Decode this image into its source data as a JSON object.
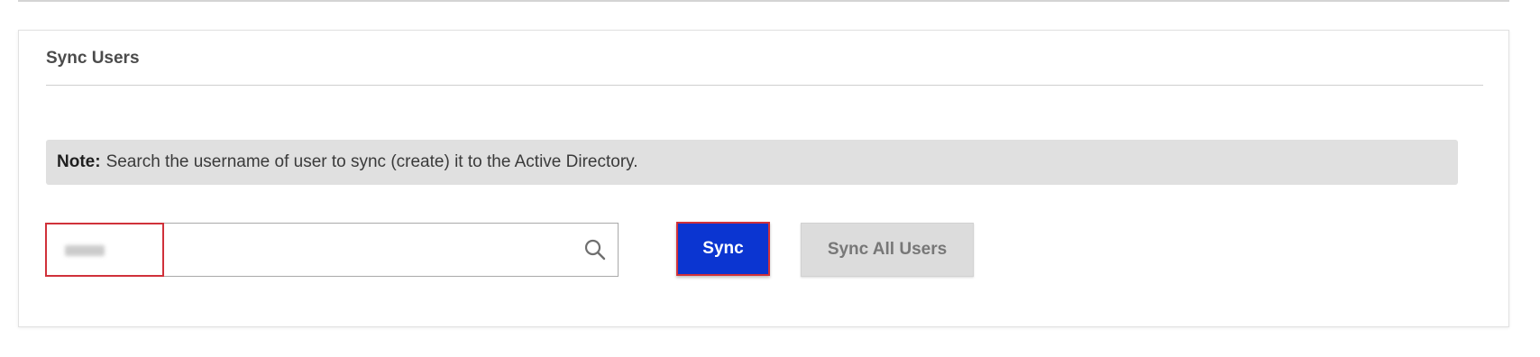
{
  "panel": {
    "title": "Sync Users",
    "note_label": "Note:",
    "note_text": "Search the username of user to sync (create) it to the Active Directory."
  },
  "search": {
    "value": "",
    "icon": "search-icon"
  },
  "buttons": {
    "sync_label": "Sync",
    "sync_all_label": "Sync All Users"
  },
  "colors": {
    "primary": "#0b35d1",
    "highlight": "#d0313a",
    "note_bg": "#e0e0e0",
    "disabled_bg": "#dcdcdc"
  }
}
